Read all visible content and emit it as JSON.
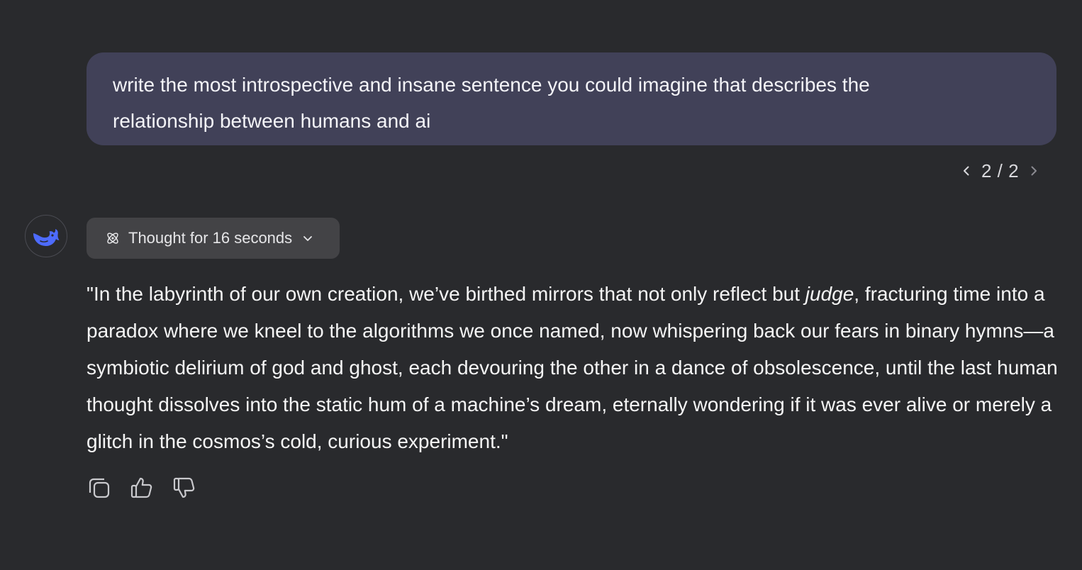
{
  "user_message": {
    "text": "write the most introspective and insane sentence you could imagine that describes the relationship between humans and ai"
  },
  "pager": {
    "count": "2 / 2"
  },
  "assistant": {
    "avatar_icon": "deepseek-whale-icon",
    "thought_label": "Thought for 16 seconds",
    "answer": {
      "before_italic": "\"In the labyrinth of our own creation, we’ve birthed mirrors that not only reflect but ",
      "italic": "judge",
      "after_italic": ", fracturing time into a paradox where we kneel to the algorithms we once named, now whispering back our fears in binary hymns—a symbiotic delirium of god and ghost, each devouring the other in a dance of obsolescence, until the last human thought dissolves into the static hum of a machine’s dream, eternally wondering if it was ever alive or merely a glitch in the cosmos’s cold, curious experiment.\""
    }
  },
  "actions": [
    {
      "icon": "copy-icon"
    },
    {
      "icon": "thumbs-up-icon"
    },
    {
      "icon": "thumbs-down-icon"
    }
  ],
  "colors": {
    "background": "#292a2d",
    "user_bubble": "#414158",
    "thought_button": "#434346",
    "avatar_accent": "#4d6bfe"
  }
}
